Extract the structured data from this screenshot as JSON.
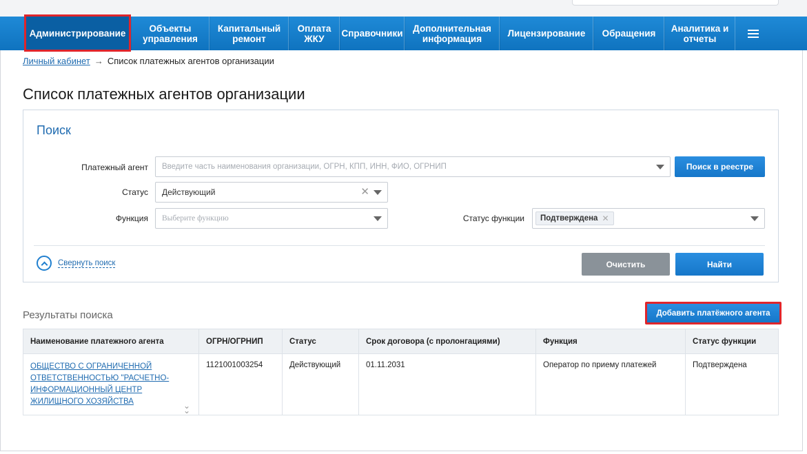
{
  "nav": {
    "items": [
      {
        "label": "Администрирование",
        "active": true
      },
      {
        "label": "Объекты\nуправления"
      },
      {
        "label": "Капитальный\nремонт"
      },
      {
        "label": "Оплата\nЖКУ"
      },
      {
        "label": "Справочники"
      },
      {
        "label": "Дополнительная\nинформация"
      },
      {
        "label": "Лицензирование"
      },
      {
        "label": "Обращения"
      },
      {
        "label": "Аналитика и\nотчеты"
      }
    ],
    "menu_icon": "hamburger-icon"
  },
  "breadcrumb": {
    "link": "Личный кабинет",
    "arrow": "→",
    "current": "Список платежных агентов организации"
  },
  "page_title": "Список платежных агентов организации",
  "search": {
    "title": "Поиск",
    "agent_label": "Платежный агент",
    "agent_placeholder": "Введите часть наименования организации, ОГРН, КПП, ИНН, ФИО, ОГРНИП",
    "registry_button": "Поиск в реестре",
    "status_label": "Статус",
    "status_value": "Действующий",
    "function_label": "Функция",
    "function_placeholder": "Выберите функцию",
    "function_status_label": "Статус функции",
    "function_status_tag": "Подтверждена",
    "collapse_label": "Свернуть поиск",
    "clear_button": "Очистить",
    "find_button": "Найти"
  },
  "results": {
    "title": "Результаты поиска",
    "add_button": "Добавить платёжного агента",
    "columns": [
      "Наименование платежного агента",
      "ОГРН/ОГРНИП",
      "Статус",
      "Срок договора (с пролонгациями)",
      "Функция",
      "Статус функции"
    ],
    "rows": [
      {
        "name": "ОБЩЕСТВО С ОГРАНИЧЕННОЙ ОТВЕТСТВЕННОСТЬЮ \"РАСЧЕТНО-ИНФОРМАЦИОННЫЙ ЦЕНТР ЖИЛИЩНОГО ХОЗЯЙСТВА",
        "ogrn": "1121001003254",
        "status": "Действующий",
        "term": "01.11.2031",
        "function": "Оператор по приему платежей",
        "function_status": "Подтверждена"
      }
    ]
  },
  "colors": {
    "nav_blue": "#1580cf",
    "highlight_red": "#e0252b",
    "link_blue": "#1f6bb0"
  }
}
